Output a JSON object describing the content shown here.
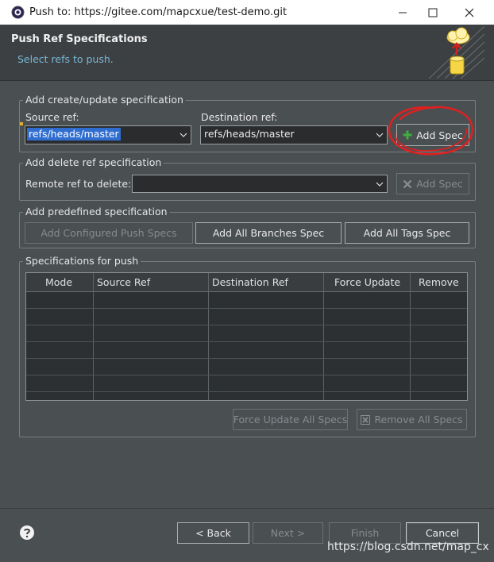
{
  "window": {
    "title": "Push to: https://gitee.com/mapcxue/test-demo.git"
  },
  "header": {
    "title": "Push Ref Specifications",
    "subtitle": "Select refs to push."
  },
  "create_update": {
    "group_label": "Add create/update specification",
    "source_label": "Source ref:",
    "source_value": "refs/heads/master",
    "destination_label": "Destination ref:",
    "destination_value": "refs/heads/master",
    "add_spec_label": "Add Spec"
  },
  "delete_ref": {
    "group_label": "Add delete ref specification",
    "remote_label": "Remote ref to delete:",
    "remote_value": "",
    "add_spec_label": "Add Spec"
  },
  "predefined": {
    "group_label": "Add predefined specification",
    "configured_label": "Add Configured Push Specs",
    "all_branches_label": "Add All Branches Spec",
    "all_tags_label": "Add All Tags Spec"
  },
  "specs": {
    "group_label": "Specifications for push",
    "columns": [
      "Mode",
      "Source Ref",
      "Destination Ref",
      "Force Update",
      "Remove"
    ],
    "rows": [],
    "force_update_all_label": "Force Update All Specs",
    "remove_all_label": "Remove All Specs"
  },
  "footer": {
    "help_icon": "help-icon",
    "back_label": "< Back",
    "next_label": "Next >",
    "finish_label": "Finish",
    "cancel_label": "Cancel",
    "watermark": "https://blog.csdn.net/map_cx"
  },
  "colors": {
    "background": "#4a4f52",
    "header": "#3c4043",
    "subtitle": "#79b7d6",
    "selection": "#2f6dcf",
    "annotation_circle": "#e02020",
    "add_icon_green": "#3fae3f"
  }
}
